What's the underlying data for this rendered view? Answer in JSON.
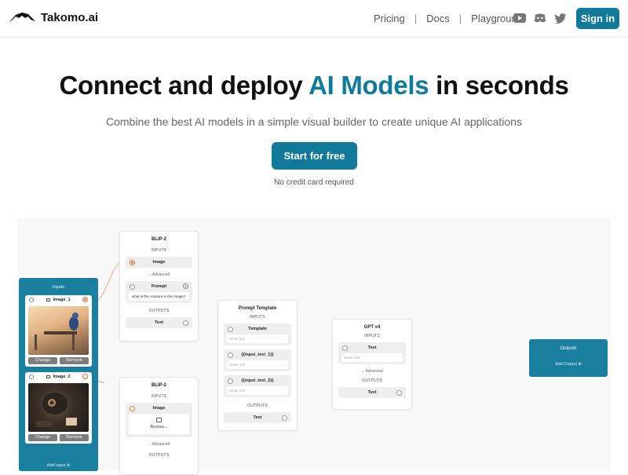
{
  "brand": {
    "name": "Takomo.ai",
    "logo_icon": "bird-logo-icon",
    "accent": "#117a9a"
  },
  "nav": {
    "links": [
      "Pricing",
      "Docs",
      "Playground"
    ],
    "social_icons": [
      "youtube-icon",
      "discord-icon",
      "twitter-icon"
    ],
    "signin_label": "Sign in"
  },
  "hero": {
    "title_pre": "Connect and deploy ",
    "title_accent": "AI Models",
    "title_post": " in seconds",
    "subtitle": "Combine the best AI models in a simple visual builder to create unique AI applications",
    "cta_label": "Start for free",
    "cta_note": "No credit card required"
  },
  "builder": {
    "inputs_panel": {
      "title": "Inputs",
      "cards": [
        {
          "name": "Image_1",
          "change": "Change",
          "remove": "Remove"
        },
        {
          "name": "Image_2",
          "change": "Change",
          "remove": "Remove"
        }
      ],
      "add_input": "Add Input"
    },
    "blip_top": {
      "title": "BLIP-2",
      "inputs_label": "INPUTS",
      "image_field": "Image",
      "advanced": "Advanced",
      "prompt_field": "Prompt",
      "prompt_value": "what is the creature in this image?",
      "outputs_label": "OUTPUTS",
      "output_field": "Text"
    },
    "blip_bottom": {
      "title": "BLIP-2",
      "inputs_label": "INPUTS",
      "image_field": "Image",
      "browse": "Browse...",
      "advanced": "Advanced",
      "outputs_label": "OUTPUTS"
    },
    "prompt_template": {
      "title": "Prompt Template",
      "inputs_label": "INPUTS",
      "fields": [
        {
          "label": "Template",
          "placeholder": "Enter text"
        },
        {
          "label": "{{input_text_1}}",
          "placeholder": "Enter text"
        },
        {
          "label": "{{input_text_2}}",
          "placeholder": "Enter text"
        }
      ],
      "outputs_label": "OUTPUTS",
      "output_field": "Text"
    },
    "gpt": {
      "title": "GPT v4",
      "inputs_label": "INPUTS",
      "text_field": "Text",
      "placeholder": "Enter text",
      "advanced": "Advanced",
      "outputs_label": "OUTPUTS",
      "output_field": "Text"
    },
    "outputs": {
      "title": "Outputs",
      "add_output": "Add Output"
    }
  }
}
